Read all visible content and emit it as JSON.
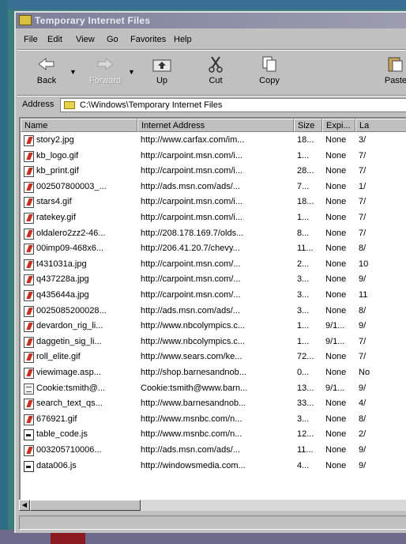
{
  "window": {
    "title": "Temporary Internet Files"
  },
  "menu": [
    "File",
    "Edit",
    "View",
    "Go",
    "Favorites",
    "Help"
  ],
  "toolbar": {
    "back": "Back",
    "forward": "Forward",
    "up": "Up",
    "cut": "Cut",
    "copy": "Copy",
    "paste": "Paste"
  },
  "address": {
    "label": "Address",
    "value": "C:\\Windows\\Temporary Internet Files"
  },
  "columns": [
    "Name",
    "Internet Address",
    "Size",
    "Expi...",
    "La"
  ],
  "files": [
    {
      "name": "story2.jpg",
      "address": "http://www.carfax.com/im...",
      "size": "18...",
      "expires": "None",
      "last": "3/",
      "icon": "image-file-icon"
    },
    {
      "name": "kb_logo.gif",
      "address": "http://carpoint.msn.com/i...",
      "size": "1...",
      "expires": "None",
      "last": "7/",
      "icon": "image-file-icon"
    },
    {
      "name": "kb_print.gif",
      "address": "http://carpoint.msn.com/i...",
      "size": "28...",
      "expires": "None",
      "last": "7/",
      "icon": "image-file-icon"
    },
    {
      "name": "002507800003_...",
      "address": "http://ads.msn.com/ads/...",
      "size": "7...",
      "expires": "None",
      "last": "1/",
      "icon": "image-file-icon"
    },
    {
      "name": "stars4.gif",
      "address": "http://carpoint.msn.com/i...",
      "size": "18...",
      "expires": "None",
      "last": "7/",
      "icon": "image-file-icon"
    },
    {
      "name": "ratekey.gif",
      "address": "http://carpoint.msn.com/i...",
      "size": "1...",
      "expires": "None",
      "last": "7/",
      "icon": "image-file-icon"
    },
    {
      "name": "oldalero2zz2-46...",
      "address": "http://208.178.169.7/olds...",
      "size": "8...",
      "expires": "None",
      "last": "7/",
      "icon": "image-file-icon"
    },
    {
      "name": "00imp09-468x6...",
      "address": "http://206.41.20.7/chevy...",
      "size": "11...",
      "expires": "None",
      "last": "8/",
      "icon": "image-file-icon"
    },
    {
      "name": "t431031a.jpg",
      "address": "http://carpoint.msn.com/...",
      "size": "2...",
      "expires": "None",
      "last": "10",
      "icon": "image-file-icon"
    },
    {
      "name": "q437228a.jpg",
      "address": "http://carpoint.msn.com/...",
      "size": "3...",
      "expires": "None",
      "last": "9/",
      "icon": "image-file-icon"
    },
    {
      "name": "q435644a.jpg",
      "address": "http://carpoint.msn.com/...",
      "size": "3...",
      "expires": "None",
      "last": "11",
      "icon": "image-file-icon"
    },
    {
      "name": "0025085200028...",
      "address": "http://ads.msn.com/ads/...",
      "size": "3...",
      "expires": "None",
      "last": "8/",
      "icon": "image-file-icon"
    },
    {
      "name": "devardon_rig_li...",
      "address": "http://www.nbcolympics.c...",
      "size": "1...",
      "expires": "9/1...",
      "last": "9/",
      "icon": "image-file-icon"
    },
    {
      "name": "daggetin_sig_li...",
      "address": "http://www.nbcolympics.c...",
      "size": "1...",
      "expires": "9/1...",
      "last": "7/",
      "icon": "image-file-icon"
    },
    {
      "name": "roll_elite.gif",
      "address": "http://www.sears.com/ke...",
      "size": "72...",
      "expires": "None",
      "last": "7/",
      "icon": "image-file-icon"
    },
    {
      "name": "viewimage.asp...",
      "address": "http://shop.barnesandnob...",
      "size": "0...",
      "expires": "None",
      "last": "No",
      "icon": "image-file-icon"
    },
    {
      "name": "Cookie:tsmith@...",
      "address": "Cookie:tsmith@www.barn...",
      "size": "13...",
      "expires": "9/1...",
      "last": "9/",
      "icon": "document-file-icon"
    },
    {
      "name": "search_text_qs...",
      "address": "http://www.barnesandnob...",
      "size": "33...",
      "expires": "None",
      "last": "4/",
      "icon": "image-file-icon"
    },
    {
      "name": "676921.gif",
      "address": "http://www.msnbc.com/n...",
      "size": "3...",
      "expires": "None",
      "last": "8/",
      "icon": "image-file-icon"
    },
    {
      "name": "table_code.js",
      "address": "http://www.msnbc.com/n...",
      "size": "12...",
      "expires": "None",
      "last": "2/",
      "icon": "script-file-icon"
    },
    {
      "name": "003205710006...",
      "address": "http://ads.msn.com/ads/...",
      "size": "11...",
      "expires": "None",
      "last": "9/",
      "icon": "image-file-icon"
    },
    {
      "name": "data006.js",
      "address": "http://windowsmedia.com...",
      "size": "4...",
      "expires": "None",
      "last": "9/",
      "icon": "script-file-icon"
    }
  ]
}
